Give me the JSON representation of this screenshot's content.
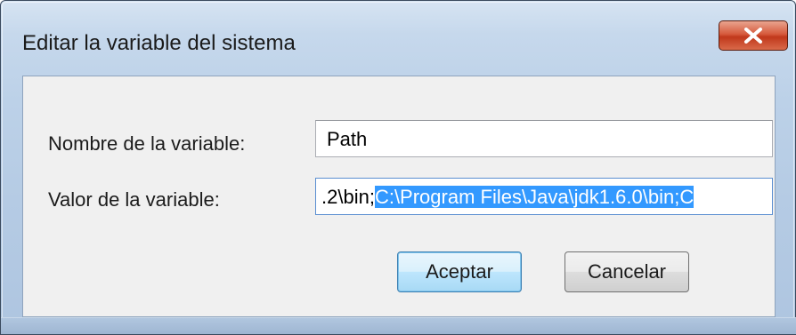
{
  "window": {
    "title": "Editar la variable del sistema",
    "close_icon": "close-x-icon",
    "accent_color": "#c0381b",
    "selection_color": "#3399ff"
  },
  "form": {
    "name_label": "Nombre de la variable:",
    "name_value": "Path",
    "value_label": "Valor de la variable:",
    "value_unselected": ".2\\bin;",
    "value_selected": "C:\\Program Files\\Java\\jdk1.6.0\\bin;",
    "value_trailing": "C"
  },
  "buttons": {
    "ok_label": "Aceptar",
    "cancel_label": "Cancelar"
  }
}
